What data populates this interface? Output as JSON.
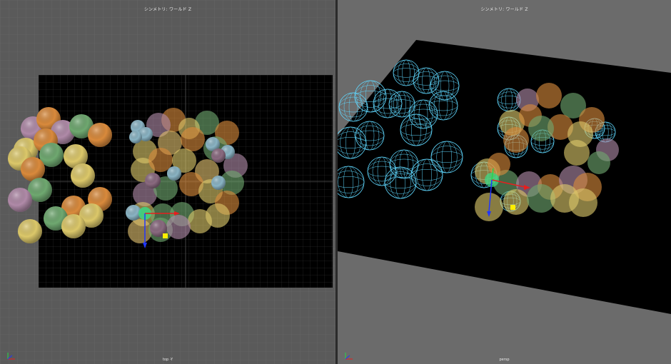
{
  "viewports": {
    "left": {
      "title": "シンメトリ: ワールド Z",
      "camera": "top -Y"
    },
    "right": {
      "title": "シンメトリ: ワールド Z",
      "camera": "persp"
    }
  },
  "colors": {
    "grid_bg": "#5a5a5a",
    "plane": "#000000",
    "wireframe": "#5fd8ff",
    "manip_x": "#e81e1e",
    "manip_y": "#26d64a",
    "manip_z": "#2036ff",
    "pivot": "#ffee00"
  }
}
